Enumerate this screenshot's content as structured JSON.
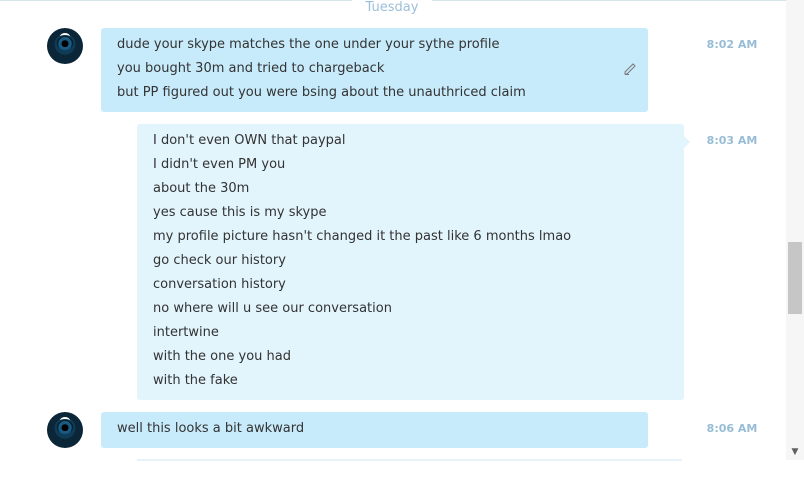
{
  "day_separator": "Tuesday",
  "messages": [
    {
      "direction": "incoming",
      "time": "8:02 AM",
      "lines": [
        "dude your skype matches the one under your sythe profile",
        "you bought 30m and tried to chargeback",
        "but PP figured out you were bsing about the unauthriced claim"
      ],
      "edit_icon": "pencil-icon"
    },
    {
      "direction": "outgoing",
      "time": "8:03 AM",
      "lines": [
        "I don't even OWN that paypal",
        "I didn't even PM you",
        "about the 30m",
        "yes cause this is my skype",
        "my profile picture hasn't changed it the past like 6 months lmao",
        "go check our history",
        "conversation history",
        "no where will u see our conversation",
        "intertwine",
        "with the one you had",
        "with the fake"
      ]
    },
    {
      "direction": "incoming",
      "time": "8:06 AM",
      "lines": [
        "well this looks a bit awkward"
      ]
    }
  ],
  "colors": {
    "incoming_bubble": "#c7ebfb",
    "outgoing_bubble": "#e2f4fc",
    "timestamp": "#97bdd6",
    "separator_text": "#9bbfd8"
  }
}
